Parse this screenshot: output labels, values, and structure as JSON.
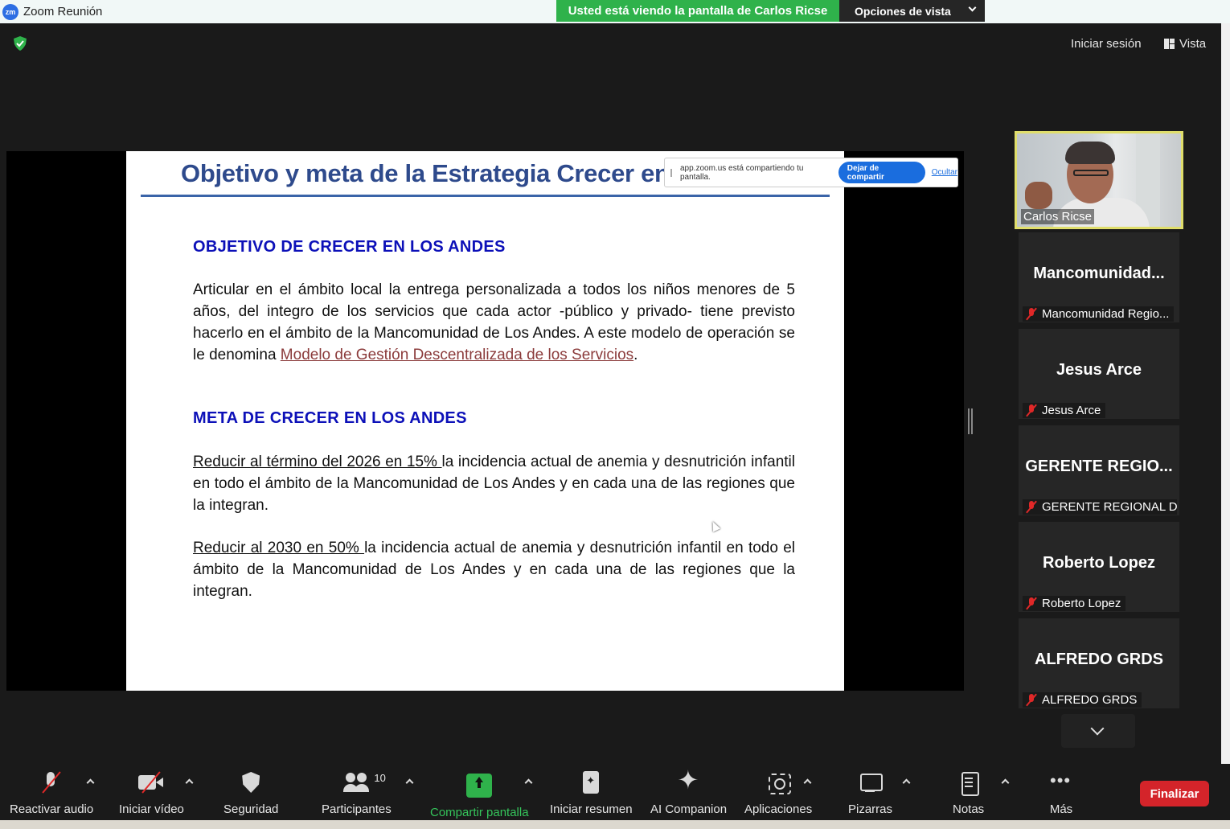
{
  "window": {
    "title": "Zoom Reunión",
    "logo_text": "zm"
  },
  "banner": {
    "viewing": "Usted está viendo la pantalla de Carlos Ricse",
    "view_options": "Opciones de vista"
  },
  "header": {
    "signin": "Iniciar sesión",
    "view": "Vista"
  },
  "share_notice": {
    "text": "app.zoom.us está compartiendo tu pantalla.",
    "stop_button": "Dejar de compartir",
    "hide_link": "Ocultar"
  },
  "slide": {
    "title": "Objetivo y meta de la Estrategia Crecer en",
    "objective_heading": "OBJETIVO DE CRECER EN LOS ANDES",
    "objective_text": "Articular en el ámbito local la entrega personalizada a todos los niños menores de 5 años, del integro de los servicios que cada actor -público y privado- tiene previsto hacerlo en el ámbito de la Mancomunidad de Los Andes. A este modelo de operación se le denomina ",
    "objective_link": "Modelo de Gestión Descentralizada de los Servicios",
    "objective_end": ".",
    "goal_heading": "META DE CRECER EN LOS ANDES",
    "goal1_underlined": "Reducir al término del 2026 en 15% ",
    "goal1_rest": "la incidencia actual de anemia y desnutrición infantil en todo el ámbito de la Mancomunidad de Los Andes y en cada una de las regiones que la integran.",
    "goal2_underlined": "Reducir al 2030 en 50% ",
    "goal2_rest": "la incidencia actual de anemia y desnutrición infantil en todo el ámbito de la Mancomunidad de Los Andes y en cada una de las regiones que la integran."
  },
  "gallery": {
    "video_name": "Carlos Ricse",
    "tiles": [
      {
        "big": "Mancomunidad...",
        "label": "Mancomunidad Regio..."
      },
      {
        "big": "Jesus Arce",
        "label": "Jesus Arce"
      },
      {
        "big": "GERENTE  REGIO...",
        "label": "GERENTE REGIONAL D..."
      },
      {
        "big": "Roberto Lopez",
        "label": "Roberto Lopez"
      },
      {
        "big": "ALFREDO GRDS",
        "label": "ALFREDO GRDS"
      }
    ]
  },
  "toolbar": {
    "audio": "Reactivar audio",
    "video": "Iniciar vídeo",
    "security": "Seguridad",
    "participants": "Participantes",
    "participants_count": "10",
    "share": "Compartir pantalla",
    "summary": "Iniciar resumen",
    "companion": "AI Companion",
    "apps": "Aplicaciones",
    "whiteboards": "Pizarras",
    "notes": "Notas",
    "more": "Más",
    "end": "Finalizar"
  },
  "colors": {
    "banner_green": "#2fb24b",
    "end_red": "#d4242a",
    "active_speaker": "#e0de6b",
    "slide_heading": "#0c10b8",
    "slide_title": "#2e4a8c"
  },
  "icons": [
    "shield-check-icon",
    "view-grid-icon",
    "mic-off-icon",
    "camera-off-icon",
    "security-shield-icon",
    "participants-icon",
    "share-screen-icon",
    "summary-icon",
    "ai-sparkle-icon",
    "apps-icon",
    "whiteboard-icon",
    "notes-icon",
    "more-icon",
    "chevron-down-icon"
  ]
}
